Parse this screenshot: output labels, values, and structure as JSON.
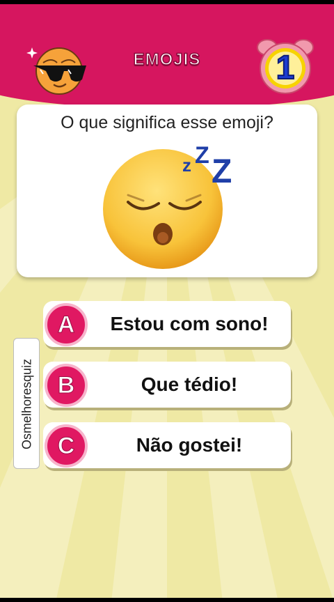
{
  "header": {
    "title": "EMOJIS"
  },
  "timer": {
    "value": "1"
  },
  "question": {
    "text": "O que significa esse emoji?"
  },
  "options": [
    {
      "letter": "A",
      "label": "Estou com sono!"
    },
    {
      "letter": "B",
      "label": "Que tédio!"
    },
    {
      "letter": "C",
      "label": "Não gostei!"
    }
  ],
  "watermark": {
    "text": "Osmelhoresquiz"
  },
  "icons": {
    "avatar": "sunglasses-sun-icon",
    "timer": "alarm-clock-icon",
    "emoji": "sleeping-face-emoji"
  },
  "colors": {
    "header": "#d6165f",
    "background": "#efe9a4",
    "accent": "#e01862",
    "timer": "#f7d300"
  }
}
